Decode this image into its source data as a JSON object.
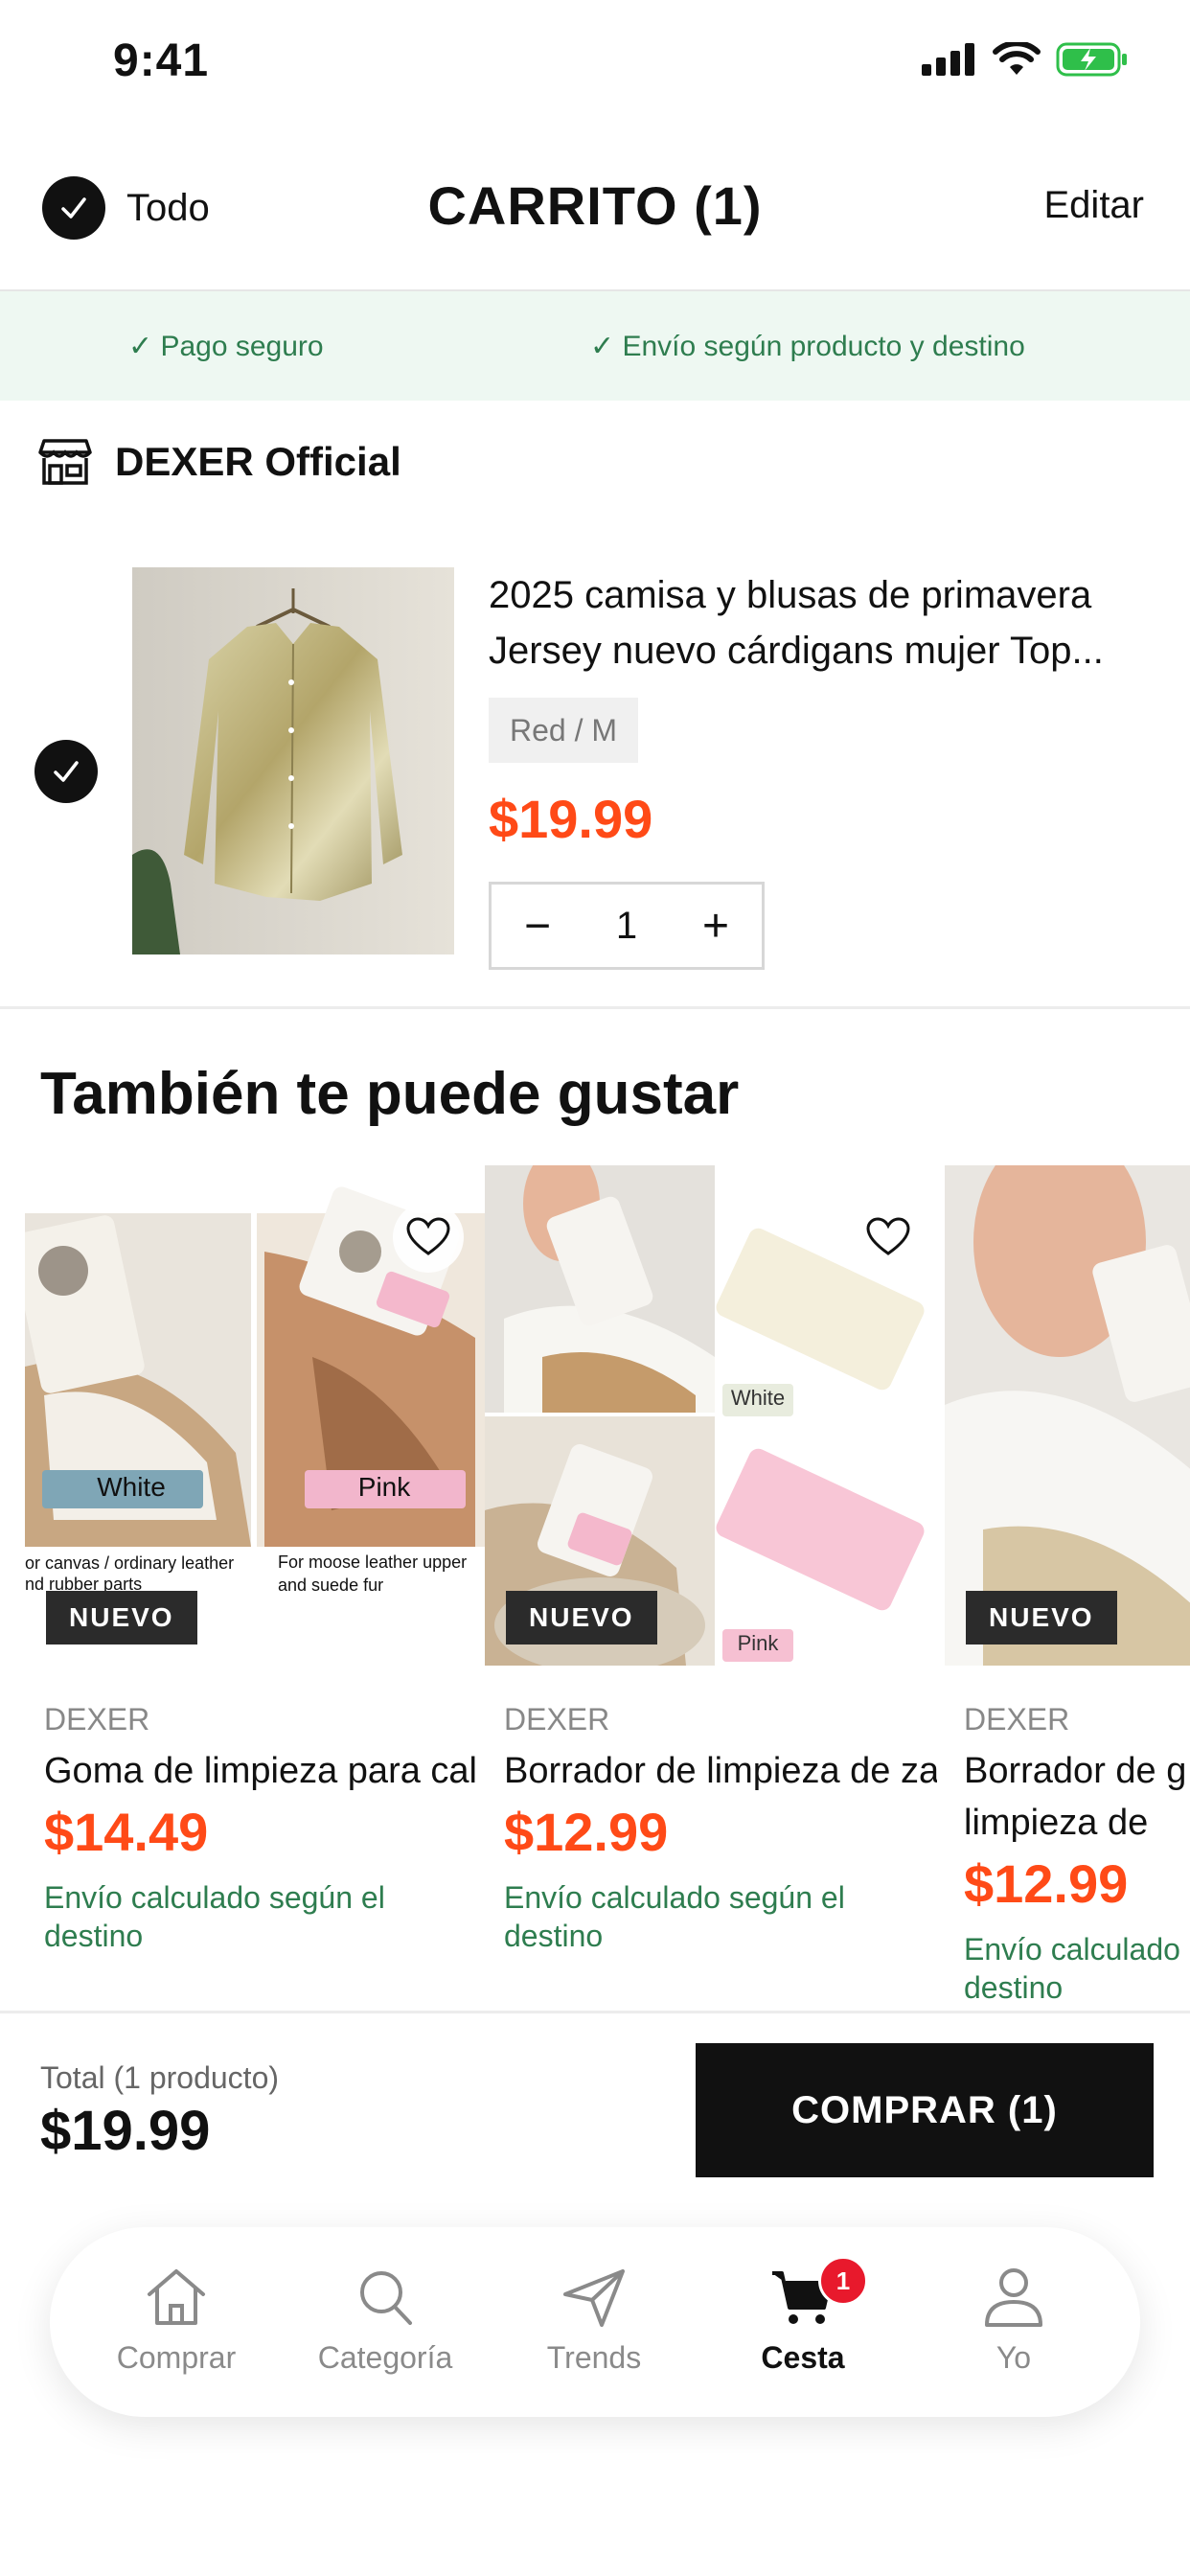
{
  "status_bar": {
    "time": "9:41"
  },
  "header": {
    "select_all_label": "Todo",
    "title": "CARRITO (1)",
    "edit_label": "Editar"
  },
  "assurance": {
    "left": "✓ Pago seguro",
    "right": "✓ Envío según producto y destino"
  },
  "store": {
    "name": "DEXER Official"
  },
  "cart_item": {
    "title": "2025 camisa y blusas de primavera Jersey nuevo cárdigans mujer Top...",
    "variant": "Red / M",
    "price": "$19.99",
    "quantity": "1",
    "minus": "−",
    "plus": "+"
  },
  "recommendations": {
    "title": "También te puede gustar",
    "items": [
      {
        "brand": "DEXER",
        "name": "Goma de limpieza para calzado de ante, piel d...",
        "price": "$14.49",
        "shipping": "Envío calculado según el destino",
        "badge": "NUEVO",
        "img_labels": [
          "White",
          "Pink"
        ],
        "img_captions": [
          "or canvas / ordinary leather nd rubber parts",
          "For moose leather upper and suede fur"
        ]
      },
      {
        "brand": "DEXER",
        "name": "Borrador de limpieza de zapatos, gamuza, piel d...",
        "price": "$12.99",
        "shipping": "Envío calculado según el destino",
        "badge": "NUEVO",
        "img_labels": [
          "White",
          "Pink"
        ]
      },
      {
        "brand": "DEXER",
        "name": "Borrador de g limpieza de ca",
        "price": "$12.99",
        "shipping": "Envío calculado destino",
        "badge": "NUEVO"
      }
    ]
  },
  "checkout": {
    "total_label": "Total (1 producto)",
    "total_value": "$19.99",
    "buy_label": "COMPRAR (1)"
  },
  "tabbar": {
    "tabs": [
      {
        "label": "Comprar",
        "icon": "home-icon"
      },
      {
        "label": "Categoría",
        "icon": "search-icon"
      },
      {
        "label": "Trends",
        "icon": "send-icon"
      },
      {
        "label": "Cesta",
        "icon": "cart-icon",
        "badge": "1",
        "active": true
      },
      {
        "label": "Yo",
        "icon": "user-icon"
      }
    ]
  },
  "colors": {
    "accent_price": "#ff4a17",
    "assurance_text": "#2e7d4f",
    "assurance_bg": "#eef8f2",
    "badge_red": "#e8192c"
  }
}
